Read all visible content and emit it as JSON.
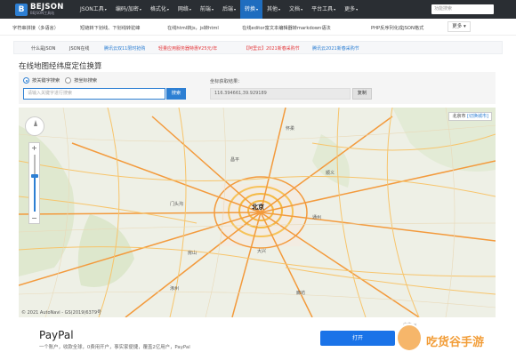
{
  "logo": {
    "mark": "B",
    "title": "BEJSON",
    "subtitle": "BEJSON工具站"
  },
  "nav": {
    "items": [
      "JSON工具",
      "编码/加密",
      "格式化",
      "网络",
      "前端",
      "后端",
      "转换",
      "其他",
      "文档",
      "平台工具",
      "更多"
    ],
    "active_index": 6,
    "search_placeholder": "功能搜索"
  },
  "toolbar": {
    "items": [
      "字符串拼接（多语言）",
      "短链转下划线、下划线转驼峰",
      "在线html转js，js转html",
      "在线editor富文本编辑器转markdown语法",
      "PHP反序列化成JSON格式"
    ],
    "more_label": "更多"
  },
  "links": [
    {
      "text": "什么是JSON",
      "color": "#444444"
    },
    {
      "text": "JSON在线",
      "color": "#444444"
    },
    {
      "text": "腾讯云双11限时抢购",
      "color": "#2d7fd3"
    },
    {
      "text": "轻量应用服务器特惠¥25元/年",
      "color": "#e4393c"
    },
    {
      "text": "【阿里云】2021新春采购节",
      "color": "#e4393c"
    },
    {
      "text": "腾讯云2021新春采购节",
      "color": "#2d7fd3"
    }
  ],
  "page_title": "在线地图经纬度定位换算",
  "search_panel": {
    "radio_options": [
      "按关键字搜索",
      "按坐标搜索"
    ],
    "selected_radio": 0,
    "keyword_placeholder": "请输入关键字进行搜索",
    "search_button": "搜索",
    "result_label": "坐标获取结果：",
    "result_value": "116.394661,39.929189",
    "copy_button": "复制"
  },
  "map": {
    "city_label": "北京市",
    "switch_label": "[切换城市]",
    "center_label": "北京",
    "place_labels": [
      "涿州",
      "大兴",
      "廊坊",
      "通州",
      "怀柔",
      "顺义",
      "昌平",
      "门头沟",
      "房山"
    ],
    "copyright": "© 2021 AutoNavi - GS(2019)6379号",
    "zoom_level": 0.62
  },
  "ad": {
    "title": "PayPal",
    "description": "一个账户，收款全球，0费用开户，事实家便捷，覆盖2亿用户，PayPal",
    "button": "打开",
    "badge": "广告 ✕"
  },
  "watermark": {
    "text": "吃货谷手游"
  }
}
